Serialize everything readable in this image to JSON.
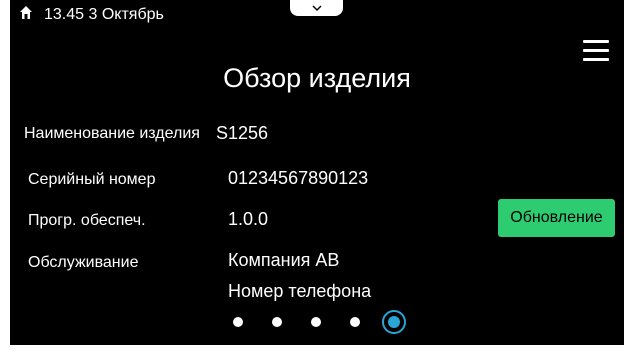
{
  "status_bar": {
    "icon": "home-icon",
    "text": "13.45 3 Октябрь"
  },
  "title": "Обзор изделия",
  "rows": {
    "product_name": {
      "label": "Наименование изделия",
      "value": "S1256"
    },
    "serial_number": {
      "label": "Серийный номер",
      "value": "01234567890123"
    },
    "software": {
      "label": "Прогр. обеспеч.",
      "value": "1.0.0"
    },
    "service": {
      "label": "Обслуживание",
      "value": "Компания АВ",
      "value2": "Номер телефона"
    }
  },
  "update_button": {
    "label": "Обновление",
    "color": "#2ecc71"
  },
  "pagination": {
    "total": 5,
    "current": 5,
    "active_color": "#2aa6d6"
  },
  "colors": {
    "background": "#000000",
    "text": "#ffffff"
  }
}
